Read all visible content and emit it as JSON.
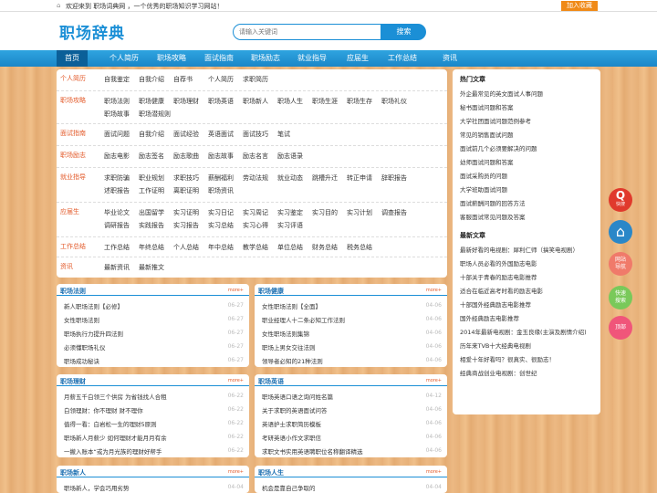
{
  "topbar": {
    "welcome": "欢迎来到 职场词典网 ，一个优秀的职场知识学习网站！",
    "favorite": "加入收藏"
  },
  "header": {
    "logo": "职场辞典",
    "search_placeholder": "请输入关键词",
    "search_button": "搜索"
  },
  "nav": [
    "首页",
    "个人简历",
    "职场攻略",
    "面试指南",
    "职场励志",
    "就业指导",
    "应届生",
    "工作总结",
    "资讯"
  ],
  "categories": [
    {
      "label": "个人简历",
      "links": [
        "自我鉴定",
        "自我介绍",
        "自荐书",
        "个人简历",
        "求职简历"
      ]
    },
    {
      "label": "职场攻略",
      "links": [
        "职场法则",
        "职场健康",
        "职场理财",
        "职场英语",
        "职场新人",
        "职场人生",
        "职场生涯",
        "职场生存",
        "职场礼仪",
        "职场故事",
        "职场潜规则"
      ]
    },
    {
      "label": "面试指南",
      "links": [
        "面试问题",
        "自我介绍",
        "面试经验",
        "英语面试",
        "面试技巧",
        "笔试"
      ]
    },
    {
      "label": "职场励志",
      "links": [
        "励志电影",
        "励志签名",
        "励志歌曲",
        "励志故事",
        "励志名言",
        "励志语录"
      ]
    },
    {
      "label": "就业指导",
      "links": [
        "求职防骗",
        "职业规划",
        "求职技巧",
        "薪酬福利",
        "劳动法规",
        "就业动态",
        "跳槽升迁",
        "转正申请",
        "辞职报告",
        "述职报告",
        "工作证明",
        "离职证明",
        "职场资讯"
      ]
    },
    {
      "label": "应届生",
      "links": [
        "毕业论文",
        "出国留学",
        "实习证明",
        "实习日记",
        "实习周记",
        "实习鉴定",
        "实习目的",
        "实习计划",
        "调查报告",
        "调研报告",
        "实践报告",
        "实习报告",
        "实习总结",
        "实习心得",
        "实习评语"
      ]
    },
    {
      "label": "工作总结",
      "links": [
        "工作总结",
        "年终总结",
        "个人总结",
        "年中总结",
        "教学总结",
        "单位总结",
        "财务总结",
        "税务总结"
      ]
    },
    {
      "label": "资讯",
      "links": [
        "最新资讯",
        "最新推文"
      ]
    }
  ],
  "sidebar": {
    "hot_title": "热门文章",
    "hot": [
      "外企最常见的英文面试人事问题",
      "秘书面试问题和答案",
      "大学社团面试问题范例参考",
      "常见的销售面试问题",
      "面试前几个必须要解决的问题",
      "幼师面试问题和答案",
      "面试采购员的问题",
      "大学班助面试问题",
      "面试薪酬问题的回答方法",
      "客服面试常见问题及答案"
    ],
    "new_title": "最新文章",
    "new": [
      "最新好看的电视剧：犀利仁师（搞笑电视剧）",
      "职场人员必看的外国励志电影",
      "十部关于青春的励志电影推荐",
      "适合在临近高考时看的励志电影",
      "十部国外经典励志电影推荐",
      "国外经典励志电影推荐",
      "2014年最新电视剧：金玉良缘(主演及剧情介绍)",
      "历年来TVB十大经典电视剧",
      "相爱十年好看吗？很真实、很励志！",
      "经典商战创业电视剧：创世纪"
    ]
  },
  "more_label": "more+",
  "boxes": [
    {
      "title": "职场法则",
      "items": [
        {
          "t": "新人职场法则【必修】",
          "d": "06-27"
        },
        {
          "t": "女性职场法则",
          "d": "06-27"
        },
        {
          "t": "职场执行力提升四法则",
          "d": "06-27"
        },
        {
          "t": "必须懂职场礼仪",
          "d": "06-27"
        },
        {
          "t": "职场成功秘诀",
          "d": "06-27"
        }
      ]
    },
    {
      "title": "职场健康",
      "items": [
        {
          "t": "女性职场法则【全面】",
          "d": "04-06"
        },
        {
          "t": "职业经理人十二条必知工作法则",
          "d": "04-06"
        },
        {
          "t": "女性职场法则集锦",
          "d": "04-06"
        },
        {
          "t": "职场上男女交往法则",
          "d": "04-06"
        },
        {
          "t": "领导者必知的21种法则",
          "d": "04-06"
        }
      ]
    },
    {
      "title": "职场理财",
      "items": [
        {
          "t": "月薪五千白领三个供房 为省钱找人合租",
          "d": "06-22"
        },
        {
          "t": "白领理财：你不理财 财不理你",
          "d": "06-22"
        },
        {
          "t": "值得一看：白岩松一生的理财5原则",
          "d": "06-22"
        },
        {
          "t": "职场新人月薪少 如何理财才能月月有余",
          "d": "06-22"
        },
        {
          "t": "一撇入账本“或为月光族的理财好帮手",
          "d": "06-22"
        }
      ]
    },
    {
      "title": "职场英语",
      "items": [
        {
          "t": "职场英语口语之询问姓名篇",
          "d": "04-12"
        },
        {
          "t": "关于求职的英语面试问答",
          "d": "04-06"
        },
        {
          "t": "英语护士求职简历模板",
          "d": "04-06"
        },
        {
          "t": "考研英语小作文求职信",
          "d": "04-06"
        },
        {
          "t": "求职文书实用英语聘职位名称翻译精选",
          "d": "04-06"
        }
      ]
    },
    {
      "title": "职场新人",
      "items": [
        {
          "t": "职场新人，学会巧用劣势",
          "d": "04-04"
        }
      ]
    },
    {
      "title": "职场人生",
      "items": [
        {
          "t": "机会是靠自己争取的",
          "d": "04-04"
        }
      ]
    }
  ],
  "float": [
    {
      "label": "快搜",
      "color": "#e0392c"
    },
    {
      "label": "",
      "color": "#2a87c8"
    },
    {
      "label": "网站导航",
      "color": "#f07a6a"
    },
    {
      "label": "快速搜索",
      "color": "#79c95a"
    },
    {
      "label": "顶部",
      "color": "#f0557a"
    }
  ]
}
